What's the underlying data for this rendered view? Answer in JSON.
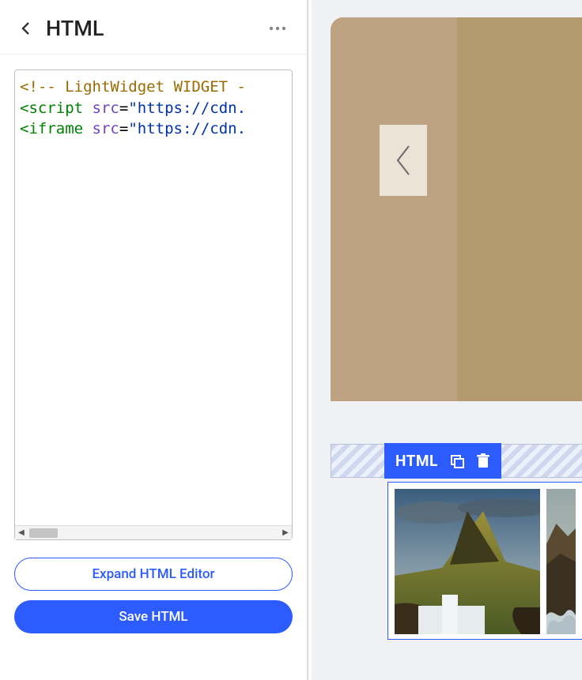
{
  "header": {
    "title": "HTML"
  },
  "editor": {
    "code_line1_comment": "<!-- LightWidget WIDGET -",
    "code_line2_tag": "<script",
    "code_line2_attr": "src",
    "code_line2_str": "\"https://cdn.",
    "code_line3_tag": "<iframe",
    "code_line3_attr": "src",
    "code_line3_str": "\"https://cdn."
  },
  "buttons": {
    "expand": "Expand HTML Editor",
    "save": "Save HTML"
  },
  "preview": {
    "badge_label": "HTML"
  }
}
